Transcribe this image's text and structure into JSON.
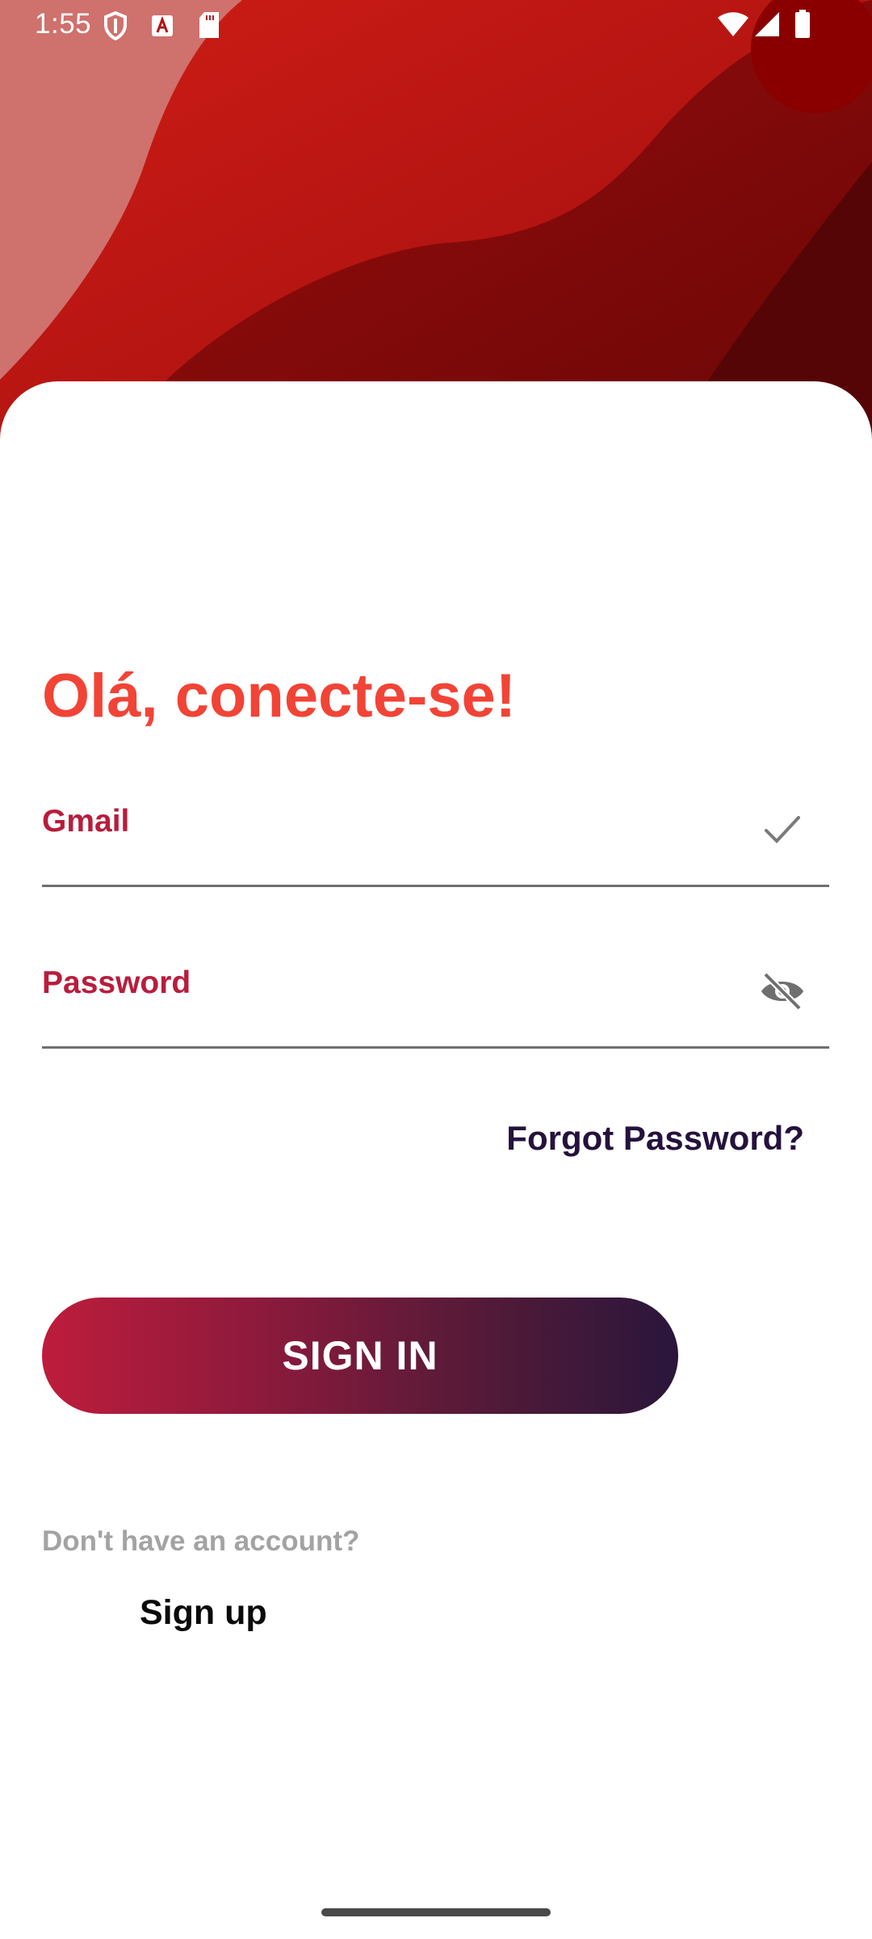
{
  "status_bar": {
    "time": "1:55",
    "left_icons": [
      "shield-icon",
      "font-a-icon",
      "sd-card-icon"
    ],
    "right_icons": [
      "wifi-icon",
      "signal-icon",
      "battery-icon"
    ]
  },
  "header": {
    "colors": {
      "base": "#b81414",
      "light": "#d27a76",
      "dark": "#7a0909",
      "darkest": "#4e0405"
    }
  },
  "login": {
    "greeting": "Olá, conecte-se!",
    "email_label": "Gmail",
    "email_icon": "check-icon",
    "password_label": "Password",
    "password_icon": "eye-off-icon",
    "forgot_password": "Forgot Password?",
    "sign_in_button": "SIGN IN",
    "no_account_text": "Don't have an account?",
    "sign_up_link": "Sign up"
  },
  "colors": {
    "accent_red": "#f14436",
    "label_crimson": "#b81d3c",
    "button_gradient_start": "#be1c3c",
    "button_gradient_end": "#2a163b",
    "link_dark": "#24123c"
  }
}
